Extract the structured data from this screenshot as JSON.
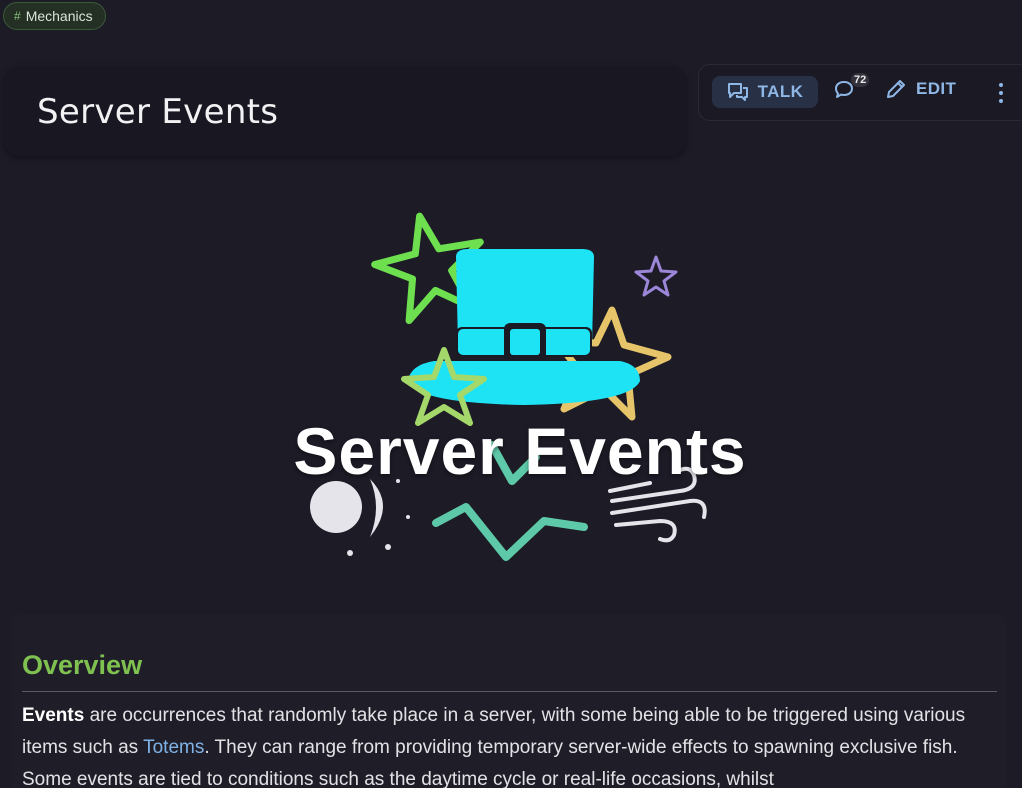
{
  "tag": {
    "hash": "#",
    "label": "Mechanics"
  },
  "page": {
    "title": "Server Events"
  },
  "actions": {
    "talk_label": "TALK",
    "comment_count": "72",
    "edit_label": "EDIT"
  },
  "hero": {
    "title": "Server Events"
  },
  "overview": {
    "heading": "Overview",
    "p_bold": "Events",
    "p_text1": " are occurrences that randomly take place in a server, with some being able to be triggered using various items such as ",
    "p_link": "Totems",
    "p_text2": ". They can range from providing temporary server-wide effects to spawning exclusive fish. Some events are tied to conditions such as the daytime cycle or real-life occasions, whilst"
  },
  "colors": {
    "accent_blue": "#8fb7e6",
    "heading_green": "#7fc151",
    "link_blue": "#7fb3e8",
    "hat_cyan": "#1ee3f5"
  }
}
